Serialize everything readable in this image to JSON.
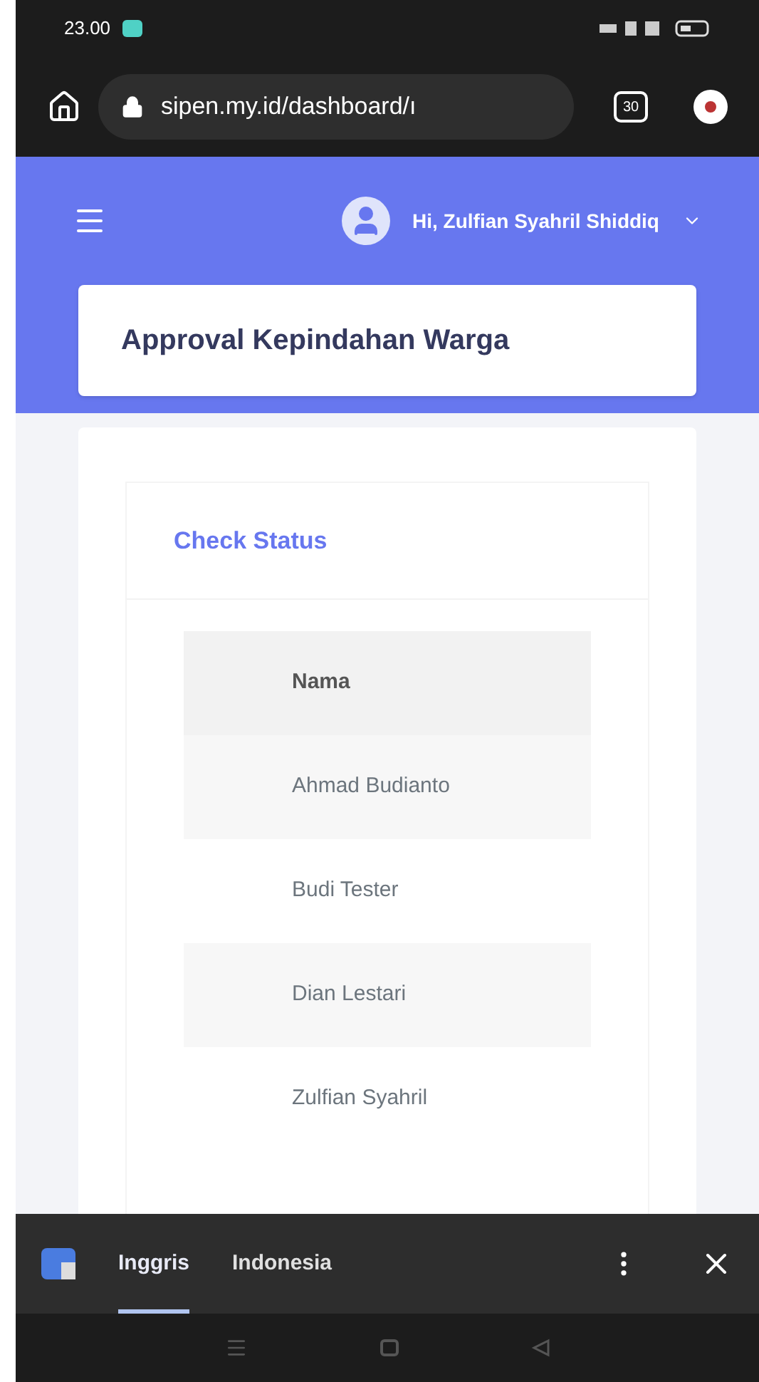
{
  "status_bar": {
    "time": "23.00"
  },
  "browser": {
    "url": "sipen.my.id/dashboard/ı",
    "tab_count": "30"
  },
  "header": {
    "greeting": "Hi, Zulfian Syahril Shiddiq"
  },
  "page_title": "Approval Kepindahan Warga",
  "card": {
    "title": "Check Status",
    "table": {
      "columns": [
        "Nama"
      ],
      "rows": [
        [
          "Ahmad Budianto"
        ],
        [
          "Budi Tester"
        ],
        [
          "Dian Lestari"
        ],
        [
          "Zulfian Syahril"
        ]
      ]
    }
  },
  "translate_bar": {
    "tabs": [
      {
        "label": "Inggris",
        "selected": true
      },
      {
        "label": "Indonesia",
        "selected": false
      }
    ]
  }
}
